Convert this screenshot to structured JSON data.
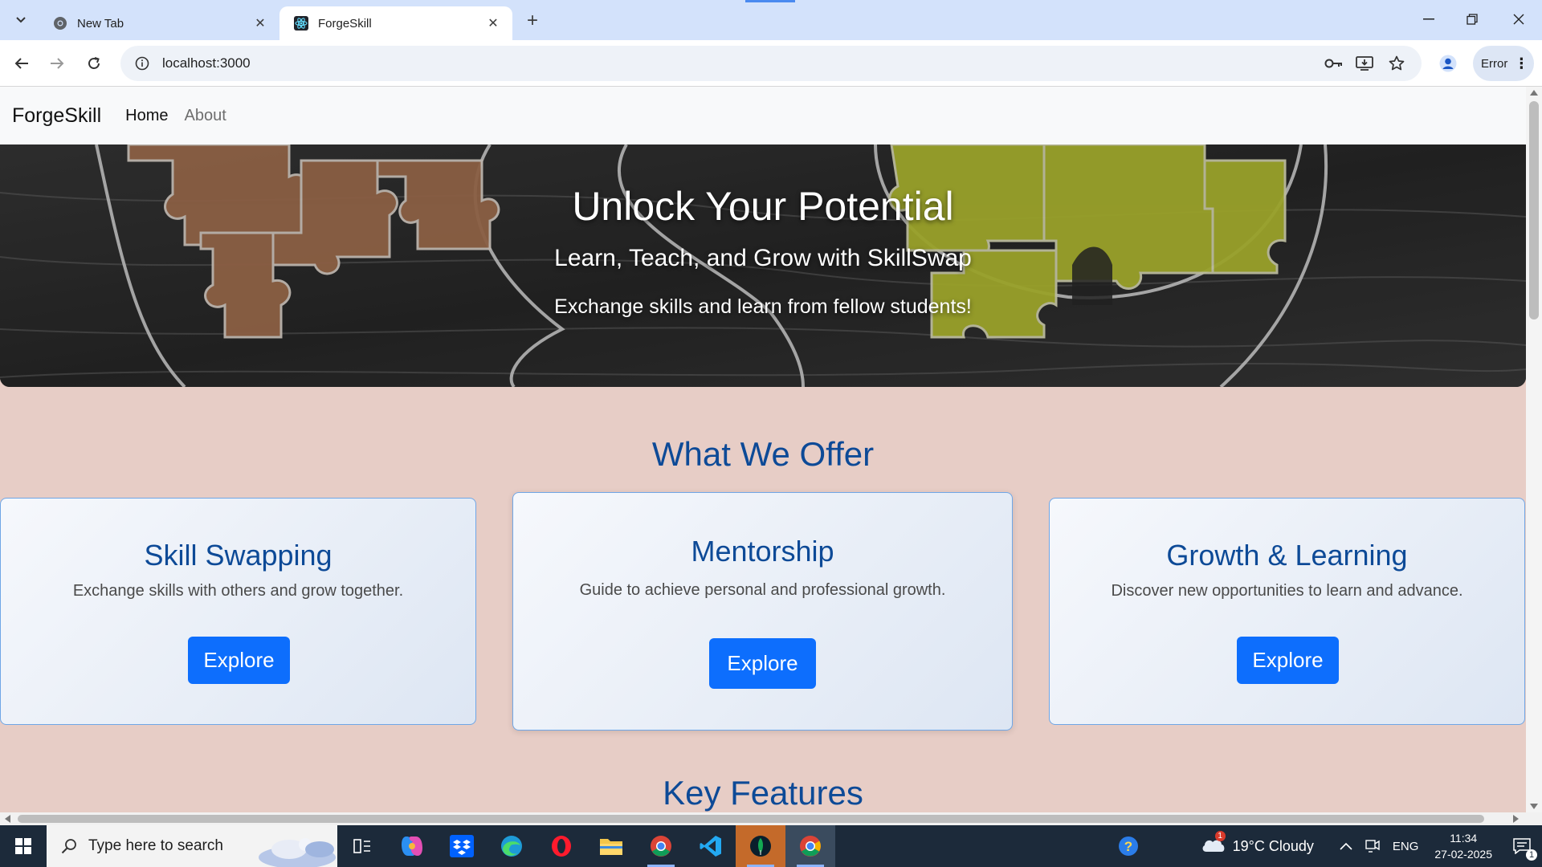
{
  "browser": {
    "tabs": [
      {
        "title": "New Tab",
        "active": false
      },
      {
        "title": "ForgeSkill",
        "active": true
      }
    ],
    "url": "localhost:3000",
    "profile_chip": "Error"
  },
  "site": {
    "brand": "ForgeSkill",
    "nav": [
      {
        "label": "Home",
        "active": true
      },
      {
        "label": "About",
        "active": false
      }
    ],
    "hero": {
      "title": "Unlock Your Potential",
      "subtitle": "Learn, Teach, and Grow with SkillSwap",
      "tagline": "Exchange skills and learn from fellow students!"
    },
    "offers": {
      "heading": "What We Offer",
      "cards": [
        {
          "title": "Skill Swapping",
          "description": "Exchange skills with others and grow together.",
          "button": "Explore"
        },
        {
          "title": "Mentorship",
          "description": "Guide to achieve personal and professional growth.",
          "button": "Explore"
        },
        {
          "title": "Growth & Learning",
          "description": "Discover new opportunities to learn and advance.",
          "button": "Explore"
        }
      ]
    },
    "features_heading": "Key Features"
  },
  "taskbar": {
    "search_placeholder": "Type here to search",
    "weather": "19°C  Cloudy",
    "weather_badge": "1",
    "language": "ENG",
    "time": "11:34",
    "date": "27-02-2025",
    "notification_count": "1"
  },
  "colors": {
    "brand_blue": "#0d6efd",
    "heading_blue": "#0d4a97",
    "page_bg": "#e7cdc6",
    "taskbar": "#1c2a3a"
  }
}
